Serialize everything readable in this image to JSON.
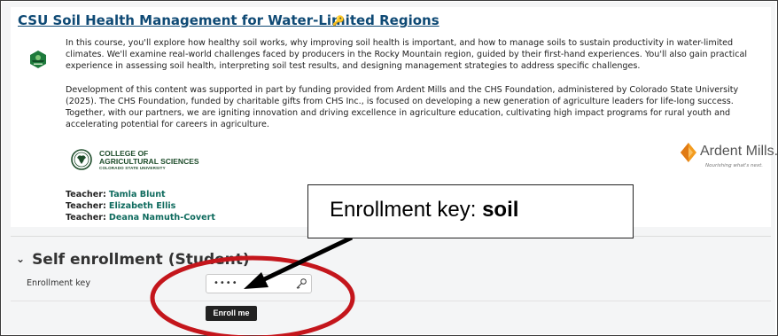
{
  "course": {
    "title": "CSU Soil Health Management for Water-Limited Regions",
    "key_symbol": "🔑",
    "summary_icon": "course-badge-icon",
    "paragraph1": "In this course, you'll explore how healthy soil works, why improving soil health is important, and how to manage soils to sustain productivity in water-limited climates. We'll examine real-world challenges faced by producers in the Rocky Mountain region, guided by their first-hand experiences. You'll also gain practical experience in assessing soil health, interpreting soil test results, and designing management strategies to address specific challenges.",
    "paragraph2": "Development of this content was supported in part by funding provided from Ardent Mills and the CHS Foundation, administered by Colorado State University (2025). The CHS Foundation, funded by charitable gifts from CHS Inc., is focused on developing a new generation of agriculture leaders for life-long success. Together, with our partners, we are igniting innovation and driving excellence in agriculture education, cultivating high impact programs for rural youth and accelerating potential for careers in agriculture.",
    "college_logo": {
      "line1": "COLLEGE OF",
      "line2": "AGRICULTURAL SCIENCES",
      "line3": "COLORADO STATE UNIVERSITY"
    },
    "sponsor_logo": {
      "name": "Ardent Mills.",
      "tagline": "Nourishing what's next."
    },
    "teachers": [
      {
        "label": "Teacher:",
        "name": "Tamla Blunt"
      },
      {
        "label": "Teacher:",
        "name": "Elizabeth Ellis"
      },
      {
        "label": "Teacher:",
        "name": "Deana Namuth-Covert"
      }
    ]
  },
  "enrollment": {
    "section_title": "Self enrollment (Student)",
    "chevron": "⌄",
    "key_label": "Enrollment key",
    "key_value": "••••",
    "button_label": "Enroll me"
  },
  "annotation": {
    "text_prefix": "Enrollment key: ",
    "text_key": "soil",
    "arrow_color": "#000000",
    "circle_color": "#c4161c"
  },
  "colors": {
    "link": "#0f4a75",
    "teacher_link": "#0f6b5e",
    "button": "#222222",
    "csu_green": "#1e4d2b",
    "ardent_orange": "#f39c1f"
  }
}
